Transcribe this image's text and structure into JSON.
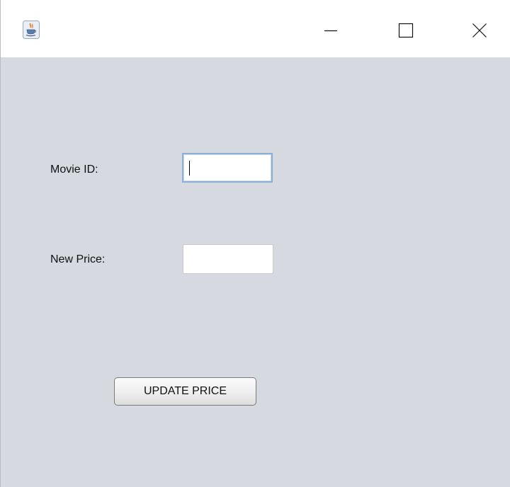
{
  "window": {
    "icon": "java-cup-icon",
    "controls": {
      "minimize": "minimize-icon",
      "maximize": "maximize-icon",
      "close": "close-icon"
    }
  },
  "form": {
    "movie_id_label": "Movie ID:",
    "movie_id_value": "",
    "new_price_label": "New Price:",
    "new_price_value": "",
    "update_button_label": "UPDATE PRICE"
  },
  "colors": {
    "content_background": "#d6d9e0",
    "title_bar": "#ffffff",
    "focused_field_border": "#8ab0d8"
  }
}
